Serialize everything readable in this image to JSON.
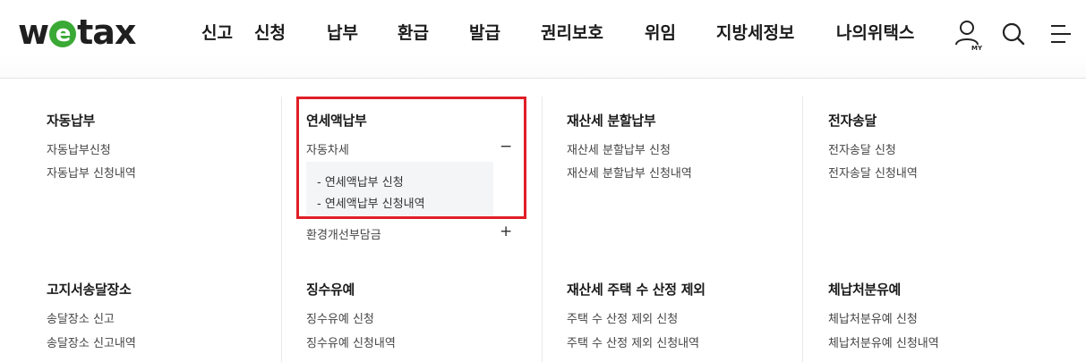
{
  "logo": {
    "part1": "w",
    "part2": "e",
    "part3": "tax"
  },
  "gnb": [
    "신고",
    "신청",
    "납부",
    "환급",
    "발급",
    "권리보호",
    "위임",
    "지방세정보",
    "나의위택스"
  ],
  "utility": {
    "my_label": "MY",
    "my_icon": "user-icon",
    "search_icon": "search-icon",
    "menu_icon": "hamburger-menu-icon"
  },
  "columns": [
    {
      "title": "자동납부",
      "links": [
        "자동납부신청",
        "자동납부 신청내역"
      ]
    },
    {
      "title": "연세액납부",
      "expand": [
        {
          "label": "자동차세",
          "symbol": "−",
          "sub": [
            "-  연세액납부 신청",
            "-  연세액납부 신청내역"
          ]
        },
        {
          "label": "환경개선부담금",
          "symbol": "+"
        }
      ]
    },
    {
      "title": "재산세 분할납부",
      "links": [
        "재산세 분할납부 신청",
        "재산세 분할납부 신청내역"
      ]
    },
    {
      "title": "전자송달",
      "links": [
        "전자송달 신청",
        "전자송달 신청내역"
      ]
    }
  ],
  "row2": [
    {
      "title": "고지서송달장소",
      "links": [
        "송달장소 신고",
        "송달장소 신고내역"
      ]
    },
    {
      "title": "징수유예",
      "links": [
        "징수유예 신청",
        "징수유예 신청내역"
      ]
    },
    {
      "title": "재산세 주택 수 산정 제외",
      "links": [
        "주택 수 산정 제외 신청",
        "주택 수 산정 제외 신청내역"
      ]
    },
    {
      "title": "체납처분유예",
      "links": [
        "체납처분유예 신청",
        "체납처분유예 신청내역"
      ]
    }
  ],
  "colors": {
    "logo_green": "#3ba935",
    "highlight_red": "#e01e26"
  }
}
